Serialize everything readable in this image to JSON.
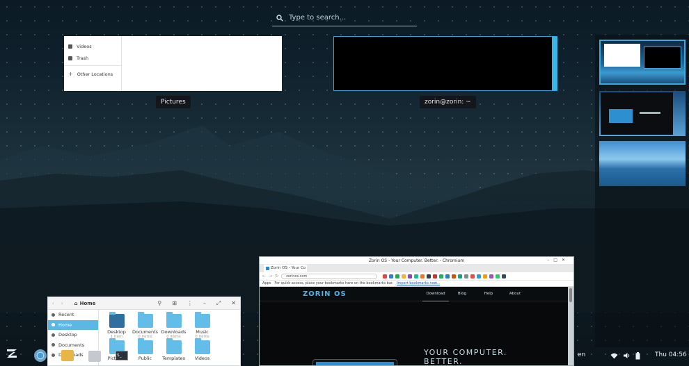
{
  "search": {
    "placeholder": "Type to search..."
  },
  "windows": {
    "files_thumb": {
      "caption": "Pictures",
      "sidebar": [
        "Videos",
        "Trash",
        "Other Locations"
      ]
    },
    "terminal_thumb": {
      "caption": "zorin@zorin: ~"
    }
  },
  "file_manager": {
    "location": "Home",
    "sidebar": [
      "Recent",
      "Home",
      "Desktop",
      "Documents",
      "Downloads"
    ],
    "folders": [
      {
        "name": "Desktop",
        "sub": "1 item"
      },
      {
        "name": "Documents",
        "sub": "0 items"
      },
      {
        "name": "Downloads",
        "sub": "0 items"
      },
      {
        "name": "Music",
        "sub": "0 items"
      },
      {
        "name": "Pictures",
        "sub": ""
      },
      {
        "name": "Public",
        "sub": ""
      },
      {
        "name": "Templates",
        "sub": ""
      },
      {
        "name": "Videos",
        "sub": ""
      }
    ]
  },
  "browser": {
    "title": "Zorin OS - Your Computer. Better. - Chromium",
    "tab_label": "Zorin OS - Your Co",
    "url": "zorinos.com",
    "bookmarks_apps": "Apps",
    "bookmarks_hint": "For quick access, place your bookmarks here on the bookmarks bar.",
    "bookmarks_import": "Import bookmarks now...",
    "site": {
      "logo": "ZORIN OS",
      "nav": [
        "Download",
        "Blog",
        "Help",
        "About"
      ],
      "hero_line1": "YOUR COMPUTER.",
      "hero_line2": "BETTER."
    }
  },
  "tray": {
    "keyboard": "en",
    "clock": "Thu 04:56"
  },
  "colors": {
    "accent": "#3ba9dd",
    "folder": "#62bde8"
  }
}
